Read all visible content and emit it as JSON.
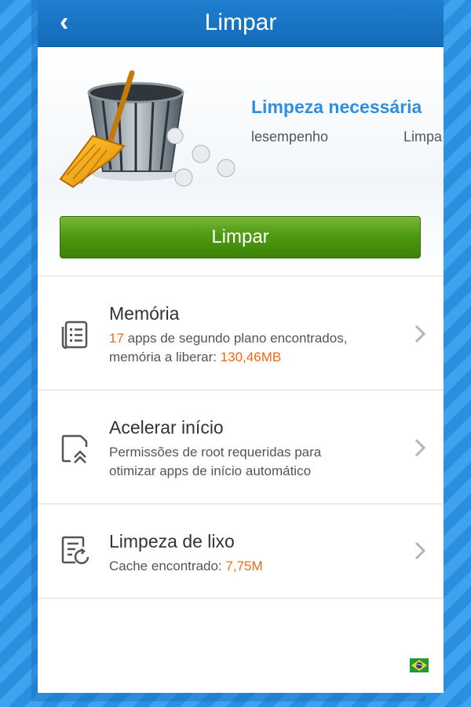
{
  "titlebar": {
    "back_glyph": "‹",
    "title": "Limpar"
  },
  "hero": {
    "status_title": "Limpeza necessária",
    "marquee": [
      "lesempenho",
      "Limpa"
    ]
  },
  "clean_button": {
    "label": "Limpar"
  },
  "items": [
    {
      "title": "Memória",
      "desc_line1_hl": "17",
      "desc_line1": " apps de segundo plano encontrados,",
      "desc_line2": "memória a liberar: ",
      "desc_line2_hl": "130,46MB",
      "icon": "list-icon"
    },
    {
      "title": "Acelerar início",
      "desc_line1": "Permissões de root requeridas para",
      "desc_line2": "otimizar apps de início automático",
      "icon": "boost-icon"
    },
    {
      "title": "Limpeza de lixo",
      "desc_line1": "Cache encontrado: ",
      "desc_line1_hl": "7,75M",
      "icon": "junk-icon"
    }
  ],
  "colors": {
    "accent": "#2f8ee0",
    "highlight": "#f06a1a",
    "button": "#4f9a12",
    "titlebar": "#1a76c6"
  },
  "flag_icon": "brazil-flag-icon"
}
